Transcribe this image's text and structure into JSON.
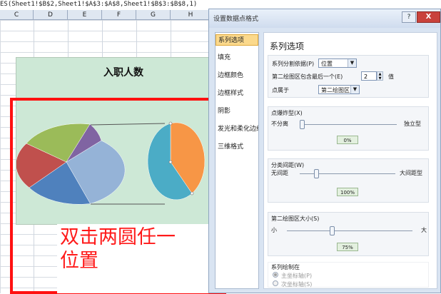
{
  "formula_bar": {
    "text": "ES(Sheet1!$B$2,Sheet1!$A$3:$A$8,Sheet1!$B$3:$B$8,1)"
  },
  "columns": [
    "C",
    "D",
    "E",
    "F",
    "G",
    "H"
  ],
  "chart": {
    "title": "入职人数",
    "primary_pie_colors": [
      "#95b3d7",
      "#4f81bd",
      "#c0504d",
      "#9bbb59",
      "#8064a2"
    ],
    "secondary_pie_colors": [
      "#f79646",
      "#4bacc6"
    ]
  },
  "caption": {
    "line1": "双击两圆任一",
    "line2": "位置"
  },
  "colors": {
    "highlight": "#ff1111",
    "selected_nav": "#fbd98c"
  },
  "dialog": {
    "title": "设置数据点格式",
    "help": "?",
    "close": "X",
    "nav": [
      "系列选项",
      "填充",
      "边框颜色",
      "边框样式",
      "阴影",
      "发光和柔化边缘",
      "三维格式"
    ],
    "heading": "系列选项",
    "split_by_label": "系列分割依据(P)",
    "split_by_value": "位置",
    "second_plot_label": "第二绘图区包含最后一个(E)",
    "second_plot_value": "2",
    "second_plot_unit": "值",
    "point_in_label": "点属于",
    "point_in_value": "第二绘图区",
    "explosion_label": "点爆炸型(X)",
    "explosion_min": "不分离",
    "explosion_max": "独立型",
    "explosion_value": "0%",
    "gap_label": "分类间距(W)",
    "gap_min": "无间距",
    "gap_max": "大间距型",
    "gap_value": "100%",
    "size_label": "第二绘图区大小(S)",
    "size_min": "小",
    "size_max": "大",
    "size_value": "75%",
    "plot_on_label": "系列绘制在",
    "primary_axis": "主坐标轴(P)",
    "secondary_axis": "次坐标轴(S)"
  }
}
